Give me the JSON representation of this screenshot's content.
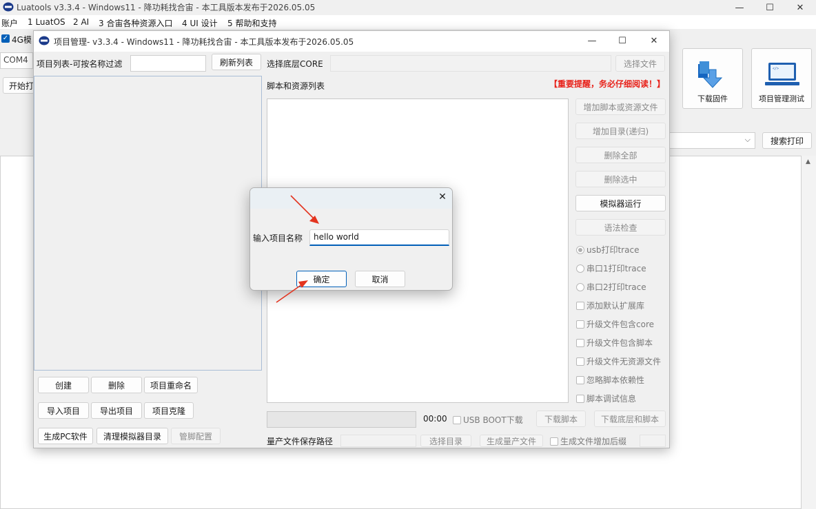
{
  "main_window": {
    "title": "Luatools  v3.3.4 - Windows11 - 降功耗找合宙 - 本工具版本发布于2026.05.05",
    "menu": [
      "账户",
      "1 LuatOS",
      "2 AI",
      "3 合宙各种资源入口",
      "4 UI 设计",
      "5 帮助和支持"
    ],
    "checkbox_4g_label": "4G模",
    "com_port": "COM4",
    "start_print_label": "开始打",
    "download_firmware_label": "下载固件",
    "project_test_label": "项目管理测试",
    "search_print_label": "搜索打印"
  },
  "project_manager": {
    "title": "项目管理- v3.3.4 - Windows11 - 降功耗找合宙 - 本工具版本发布于2026.05.05",
    "filter_label": "项目列表-可按名称过滤",
    "filter_value": "",
    "refresh_label": "刷新列表",
    "core_label": "选择底层CORE",
    "core_value": "",
    "select_file_label": "选择文件",
    "scripts_label": "脚本和资源列表",
    "warning": "【重要提醒，务必仔细阅读！】",
    "side_buttons": {
      "add_script": "增加脚本或资源文件",
      "add_dir": "增加目录(递归)",
      "delete_all": "删除全部",
      "delete_selected": "删除选中",
      "emulator_run": "模拟器运行",
      "syntax_check": "语法检查"
    },
    "radios": [
      "usb打印trace",
      "串口1打印trace",
      "串口2打印trace"
    ],
    "checks": [
      "添加默认扩展库",
      "升级文件包含core",
      "升级文件包含脚本",
      "升级文件无资源文件",
      "忽略脚本依赖性",
      "脚本调试信息"
    ],
    "bottom_left": {
      "create": "创建",
      "delete": "删除",
      "rename": "项目重命名",
      "import": "导入项目",
      "export": "导出项目",
      "clone": "项目克隆",
      "gen_pc": "生成PC软件",
      "clean_emu": "清理模拟器目录",
      "pin_config": "管脚配置"
    },
    "progress_time": "00:00",
    "usb_boot_label": "USB BOOT下载",
    "download_script": "下载脚本",
    "download_core_script": "下载底层和脚本",
    "mass_path_label": "量产文件保存路径",
    "select_dir": "选择目录",
    "gen_mass": "生成量产文件",
    "gen_suffix_label": "生成文件增加后缀"
  },
  "dialog": {
    "prompt": "输入项目名称",
    "input_value": "hello world",
    "ok": "确定",
    "cancel": "取消"
  },
  "colors": {
    "warning_red": "#e8221a",
    "accent_blue": "#005fb8",
    "annotation_arrow": "#e3341f"
  }
}
